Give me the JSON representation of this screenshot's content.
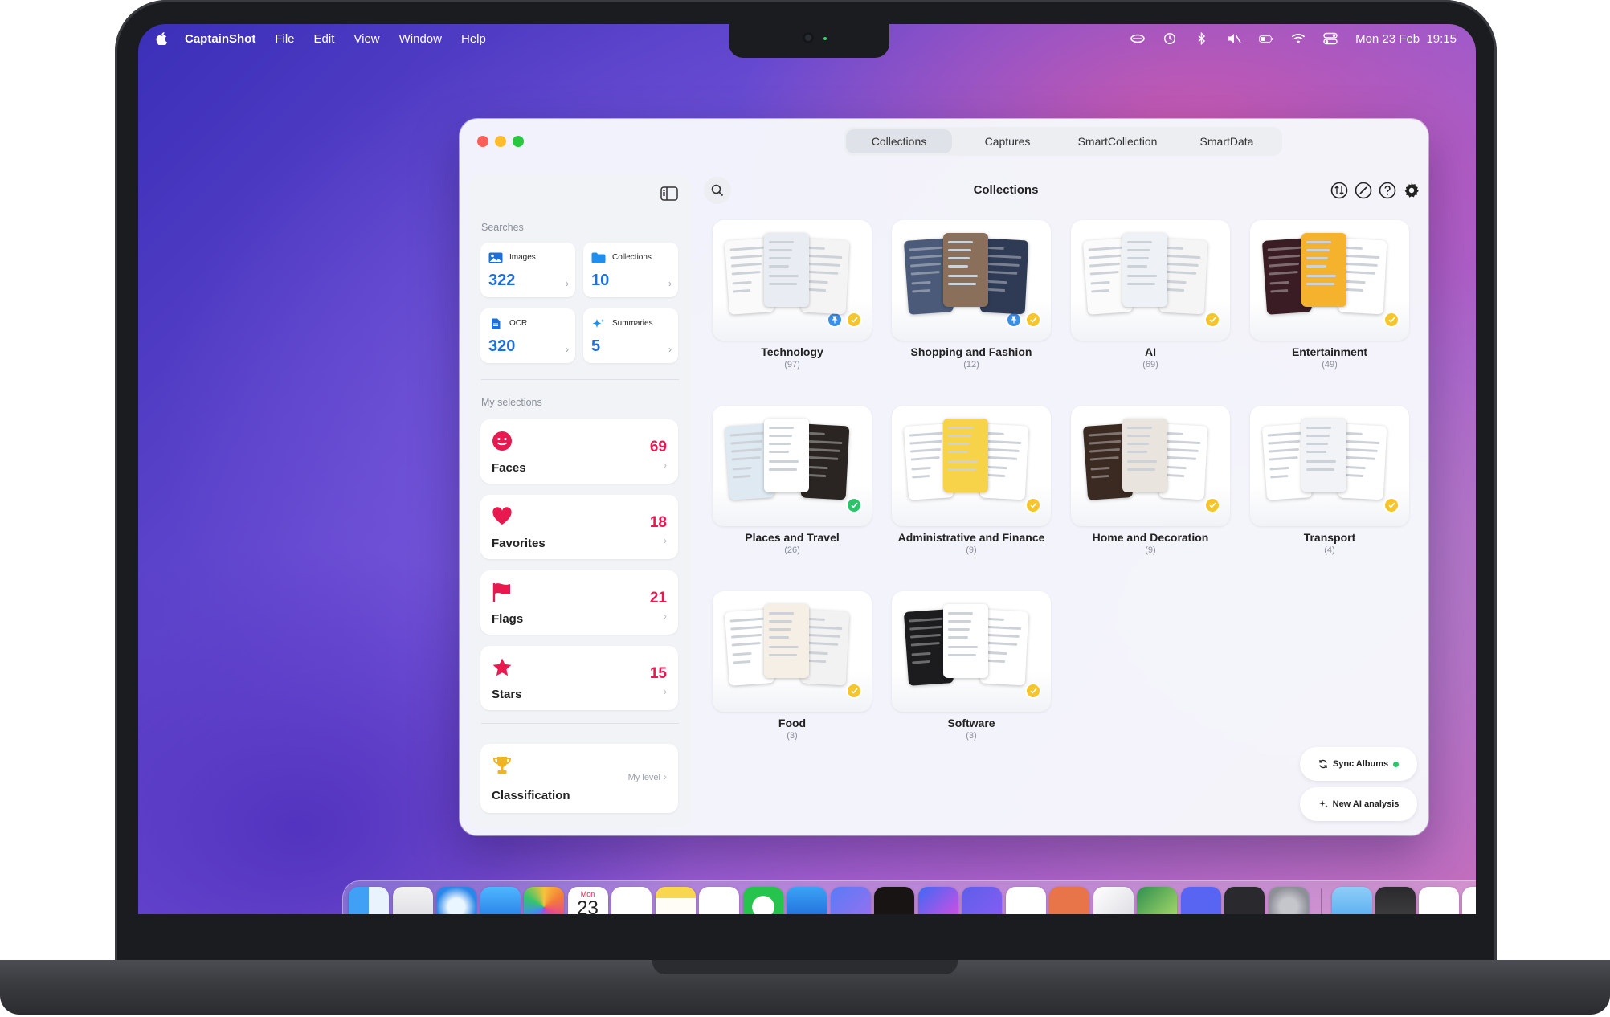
{
  "menubar": {
    "app_name": "CaptainShot",
    "menus": [
      "File",
      "Edit",
      "View",
      "Window",
      "Help"
    ],
    "clock": "Mon 23 Feb  19:15"
  },
  "window": {
    "tabs": [
      "Collections",
      "Captures",
      "SmartCollection",
      "SmartData"
    ],
    "active_tab": "Collections",
    "title": "Collections"
  },
  "sidebar": {
    "searches_label": "Searches",
    "searches": [
      {
        "label": "Images",
        "value": "322",
        "icon": "image-icon"
      },
      {
        "label": "Collections",
        "value": "10",
        "icon": "folder-icon"
      },
      {
        "label": "OCR",
        "value": "320",
        "icon": "document-icon"
      },
      {
        "label": "Summaries",
        "value": "5",
        "icon": "sparkle-icon"
      }
    ],
    "selections_label": "My selections",
    "selections": [
      {
        "label": "Faces",
        "value": "69",
        "icon": "face-icon"
      },
      {
        "label": "Favorites",
        "value": "18",
        "icon": "heart-icon"
      },
      {
        "label": "Flags",
        "value": "21",
        "icon": "flag-icon"
      },
      {
        "label": "Stars",
        "value": "15",
        "icon": "star-icon"
      }
    ],
    "classification": {
      "label": "Classification",
      "level_label": "My level",
      "icon": "trophy-icon"
    }
  },
  "collections": [
    {
      "name": "Technology",
      "count": "(97)",
      "pinned": true,
      "status": "yellow"
    },
    {
      "name": "Shopping and Fashion",
      "count": "(12)",
      "pinned": true,
      "status": "yellow"
    },
    {
      "name": "AI",
      "count": "(69)",
      "pinned": false,
      "status": "yellow"
    },
    {
      "name": "Entertainment",
      "count": "(49)",
      "pinned": false,
      "status": "yellow"
    },
    {
      "name": "Places and Travel",
      "count": "(26)",
      "pinned": false,
      "status": "green"
    },
    {
      "name": "Administrative and Finance",
      "count": "(9)",
      "pinned": false,
      "status": "yellow"
    },
    {
      "name": "Home and Decoration",
      "count": "(9)",
      "pinned": false,
      "status": "yellow"
    },
    {
      "name": "Transport",
      "count": "(4)",
      "pinned": false,
      "status": "yellow"
    },
    {
      "name": "Food",
      "count": "(3)",
      "pinned": false,
      "status": "yellow"
    },
    {
      "name": "Software",
      "count": "(3)",
      "pinned": false,
      "status": "yellow"
    }
  ],
  "actions": {
    "sync_label": "Sync Albums",
    "ai_label": "New AI analysis"
  },
  "colors": {
    "accent_blue": "#1e6fd9",
    "accent_red": "#e8194f",
    "badge_yellow": "#f5c52b",
    "badge_green": "#2cc46b",
    "pin_blue": "#3a8ee6"
  },
  "calendar_icon": {
    "month": "Mon",
    "day": "23"
  }
}
